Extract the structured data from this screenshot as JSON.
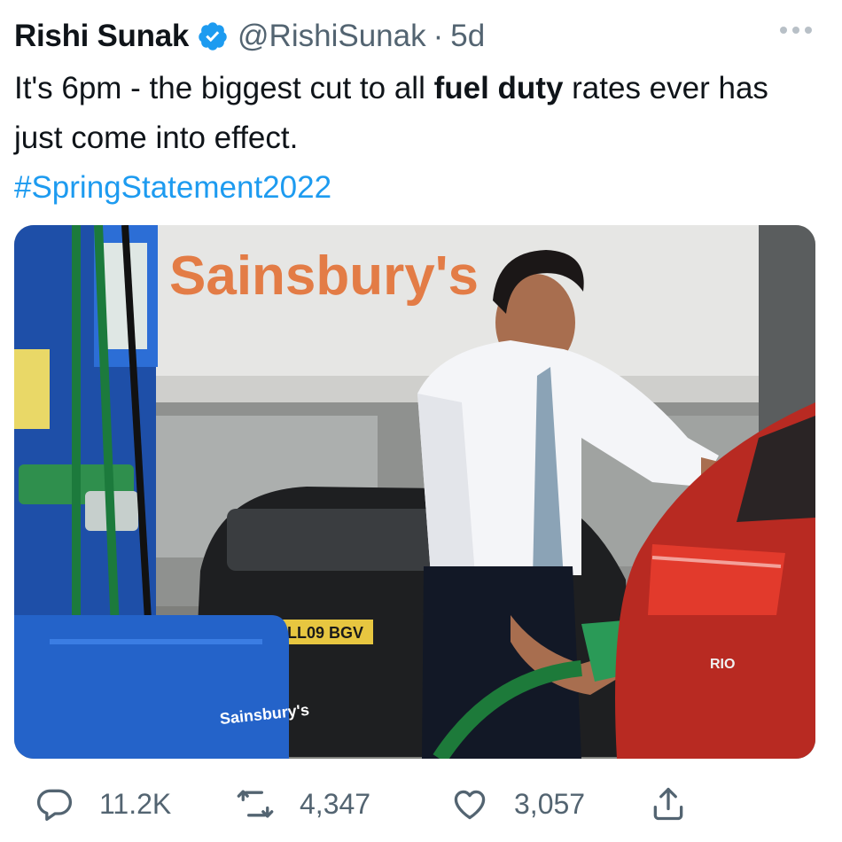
{
  "author": {
    "name": "Rishi Sunak",
    "handle": "@RishiSunak",
    "separator": "·",
    "time": "5d"
  },
  "tweet": {
    "text_before": "It's 6pm - the biggest cut to all ",
    "text_bold": "fuel duty",
    "text_after": " rates ever has just come into effect.",
    "hashtag": "#SpringStatement2022"
  },
  "media": {
    "store_sign": "Sainsbury's",
    "pump_logo": "Sainsbury's",
    "plate": "LL09 BGV",
    "car_badge": "RIO"
  },
  "actions": {
    "replies": "11.2K",
    "retweets": "4,347",
    "likes": "3,057"
  },
  "icons": {
    "verified": "verified-badge-icon",
    "more": "more-icon",
    "reply": "reply-icon",
    "retweet": "retweet-icon",
    "like": "heart-icon",
    "share": "share-icon"
  },
  "colors": {
    "accent": "#1d9bf0",
    "text": "#0f1419",
    "muted": "#536471",
    "sainsburys_orange": "#e36a2b",
    "pump_blue": "#1e4fa8"
  }
}
